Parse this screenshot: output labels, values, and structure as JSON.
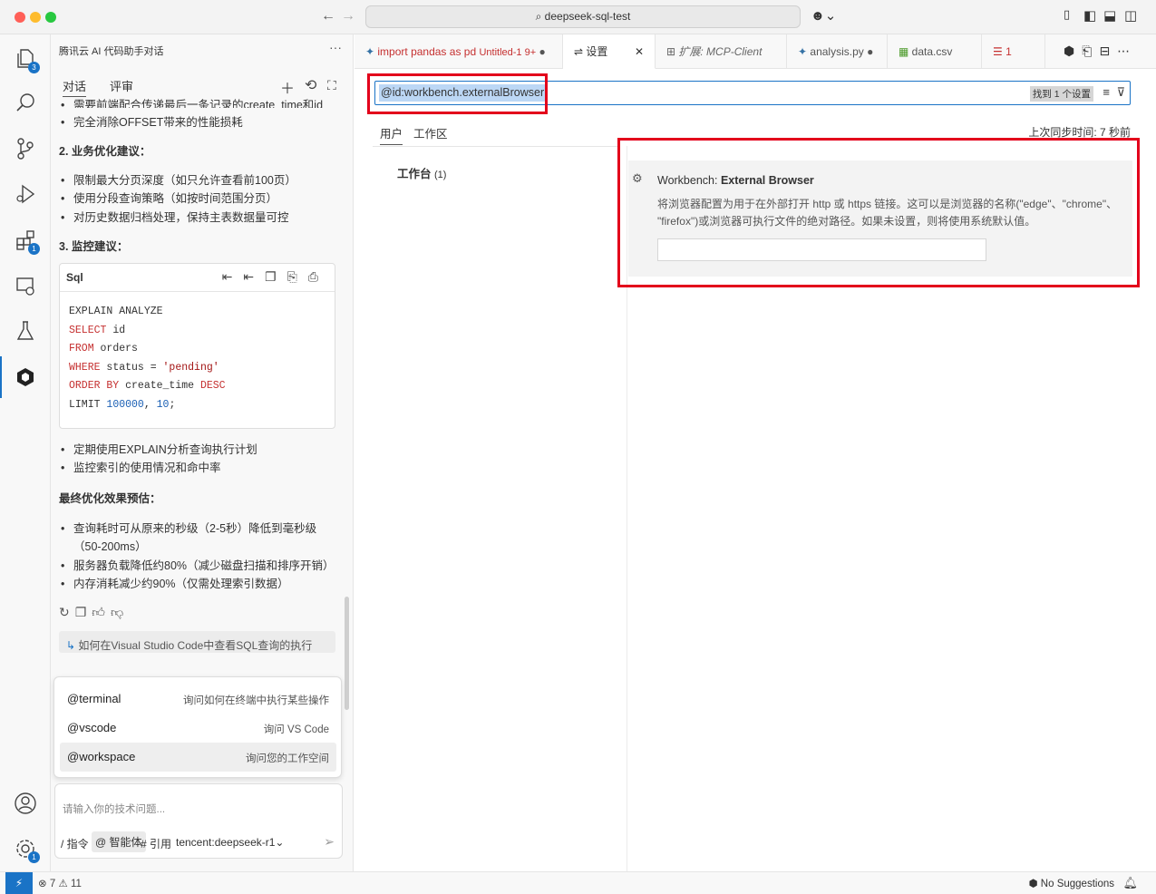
{
  "window": {
    "search": "deepseek-sql-test"
  },
  "panel": {
    "title": "腾讯云 AI 代码助手对话",
    "more": "···",
    "tabs": [
      "对话",
      "评审"
    ],
    "content": {
      "top_cut": "需要前端配合传递最后一条记录的create_time和id",
      "line1": "完全消除OFFSET带来的性能损耗",
      "h2": "2. 业务优化建议：",
      "b2": [
        "限制最大分页深度（如只允许查看前100页）",
        "使用分段查询策略（如按时间范围分页）",
        "对历史数据归档处理，保持主表数据量可控"
      ],
      "h3": "3. 监控建议：",
      "code_lang": "Sql",
      "code": {
        "l1": "EXPLAIN ANALYZE",
        "l2a": "SELECT",
        "l2b": " id",
        "l3a": "FROM",
        "l3b": " orders",
        "l4a": "WHERE",
        "l4b": " status = ",
        "l4c": "'pending'",
        "l5a": "ORDER BY",
        "l5b": " create_time ",
        "l5c": "DESC",
        "l6a": "LIMIT ",
        "l6b": "100000",
        "l6c": ", ",
        "l6d": "10",
        "l6e": ";"
      },
      "b3": [
        "定期使用EXPLAIN分析查询执行计划",
        "监控索引的使用情况和命中率"
      ],
      "h4": "最终优化效果预估：",
      "b4": [
        "查询耗时可从原来的秒级（2-5秒）降低到毫秒级（50-200ms）",
        "服务器负载降低约80%（减少磁盘扫描和排序开销）",
        "内存消耗减少约90%（仅需处理索引数据）"
      ],
      "suggest": "如何在Visual Studio Code中查看SQL查询的执行"
    },
    "popup": [
      {
        "name": "@terminal",
        "desc": "询问如何在终端中执行某些操作"
      },
      {
        "name": "@vscode",
        "desc": "询问 VS Code"
      },
      {
        "name": "@workspace",
        "desc": "询问您的工作空间"
      }
    ],
    "input": {
      "placeholder": "请输入你的技术问题...",
      "cmd": "/ 指令",
      "agent": "@ 智能体",
      "ref": "# 引用",
      "model": "tencent:deepseek-r1"
    }
  },
  "tabs": [
    {
      "label": "import pandas as pd",
      "extra": "Untitled-1 9+"
    },
    {
      "label": "设置"
    },
    {
      "label": "扩展: MCP-Client"
    },
    {
      "label": "analysis.py"
    },
    {
      "label": "data.csv"
    },
    {
      "label": "1"
    }
  ],
  "settings": {
    "search_value": "@id:workbench.externalBrowser",
    "found": "找到 1 个设置",
    "scope_tabs": [
      "用户",
      "工作区"
    ],
    "sync": "上次同步时间: 7 秒前",
    "tree_item": "工作台",
    "tree_count": "(1)",
    "setting_prefix": "Workbench: ",
    "setting_name": "External Browser",
    "setting_desc_1": "将浏览器配置为用于在外部打开 http 或 https 链接。这可以是浏览器的名称(\"edge\"、\"chrome\"、",
    "setting_desc_2": "\"firefox\")或浏览器可执行文件的绝对路径。如果未设置，则将使用系统默认值。"
  },
  "status": {
    "errors": "7",
    "warnings": "11",
    "suggestions": "No Suggestions"
  },
  "colors": {
    "accent": "#1a73c6",
    "highlight": "#e3001b"
  }
}
